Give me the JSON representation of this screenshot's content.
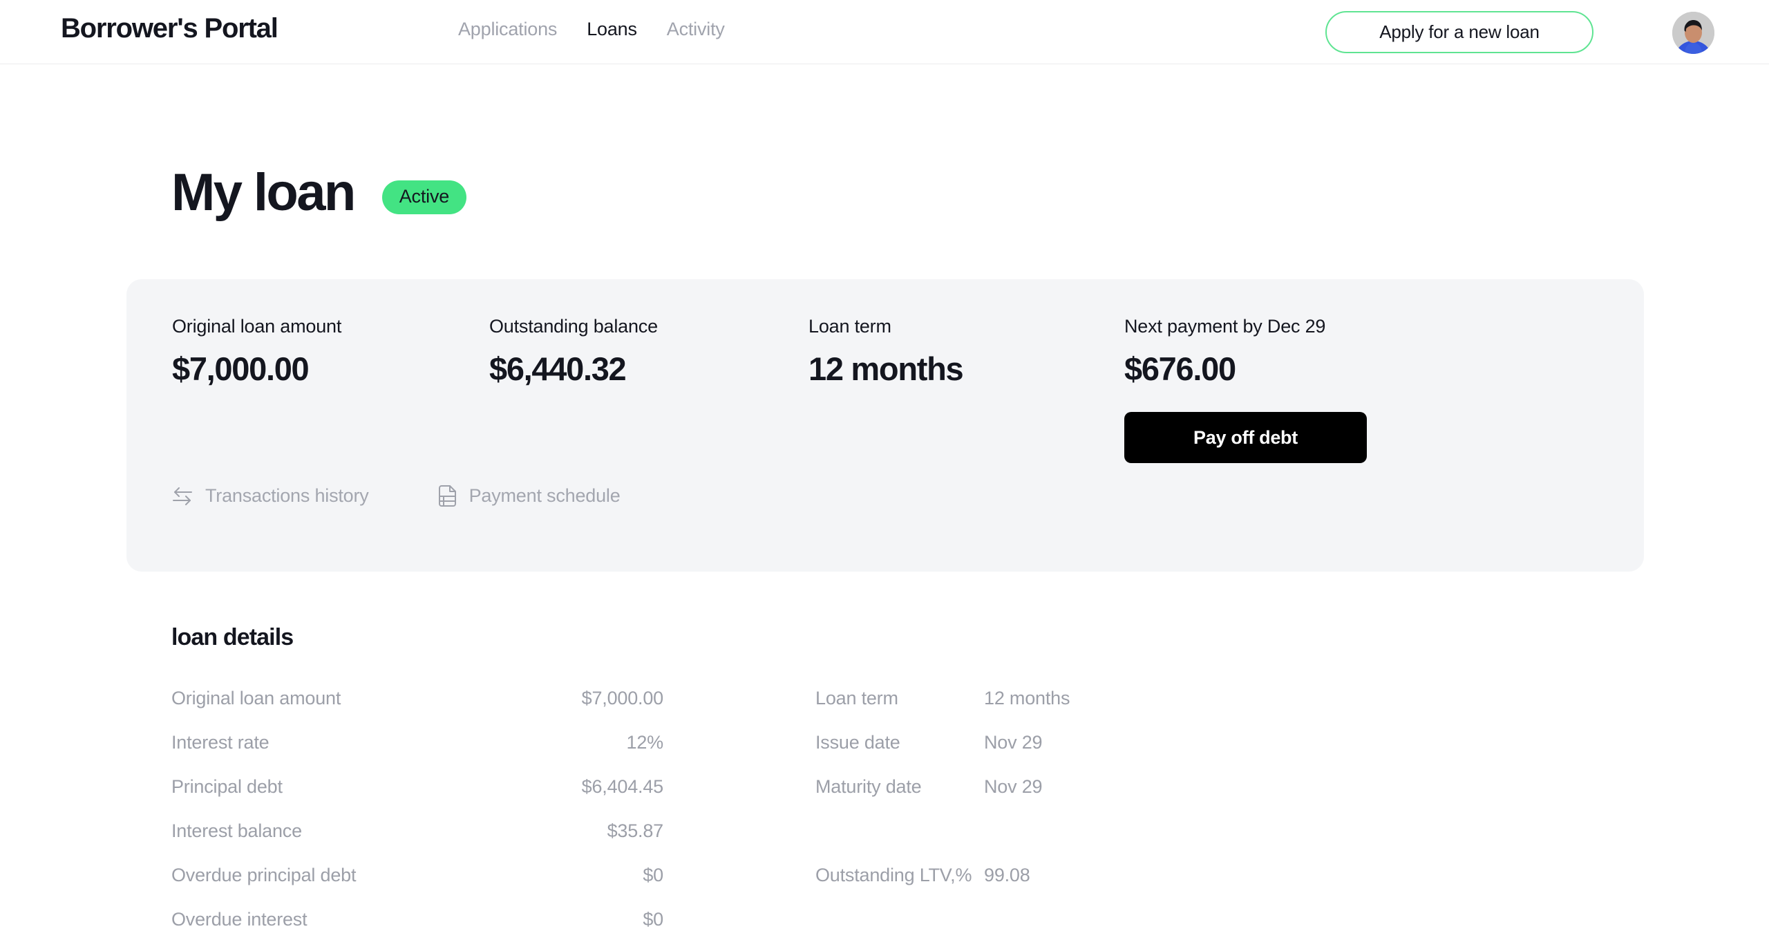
{
  "header": {
    "brand": "Borrower's Portal",
    "nav": [
      {
        "label": "Applications",
        "active": false
      },
      {
        "label": "Loans",
        "active": true
      },
      {
        "label": "Activity",
        "active": false
      }
    ],
    "apply_button": "Apply for a new loan",
    "avatar_alt": "user-avatar"
  },
  "page": {
    "title": "My loan",
    "status": "Active",
    "status_color": "#43e383"
  },
  "summary": {
    "stats": [
      {
        "label": "Original loan amount",
        "value": "$7,000.00"
      },
      {
        "label": "Outstanding balance",
        "value": "$6,440.32"
      },
      {
        "label": "Loan term",
        "value": "12 months"
      },
      {
        "label": "Next payment by Dec 29",
        "value": "$676.00"
      }
    ],
    "payoff_button": "Pay off debt",
    "links": [
      {
        "label": "Transactions history",
        "icon": "transfer-arrows-icon"
      },
      {
        "label": "Payment schedule",
        "icon": "document-table-icon"
      }
    ]
  },
  "details": {
    "heading": "loan details",
    "left": [
      {
        "label": "Original loan amount",
        "value": "$7,000.00"
      },
      {
        "label": "Interest rate",
        "value": "12%"
      },
      {
        "label": "Principal debt",
        "value": "$6,404.45"
      },
      {
        "label": "Interest balance",
        "value": "$35.87"
      },
      {
        "label": "Overdue principal debt",
        "value": "$0"
      },
      {
        "label": "Overdue interest",
        "value": "$0"
      }
    ],
    "right": [
      {
        "label": "Loan term",
        "value": "12 months"
      },
      {
        "label": "Issue date",
        "value": "Nov 29"
      },
      {
        "label": "Maturity date",
        "value": "Nov 29"
      },
      {
        "label": "",
        "value": ""
      },
      {
        "label": "Outstanding LTV,%",
        "value": "99.08"
      }
    ]
  }
}
